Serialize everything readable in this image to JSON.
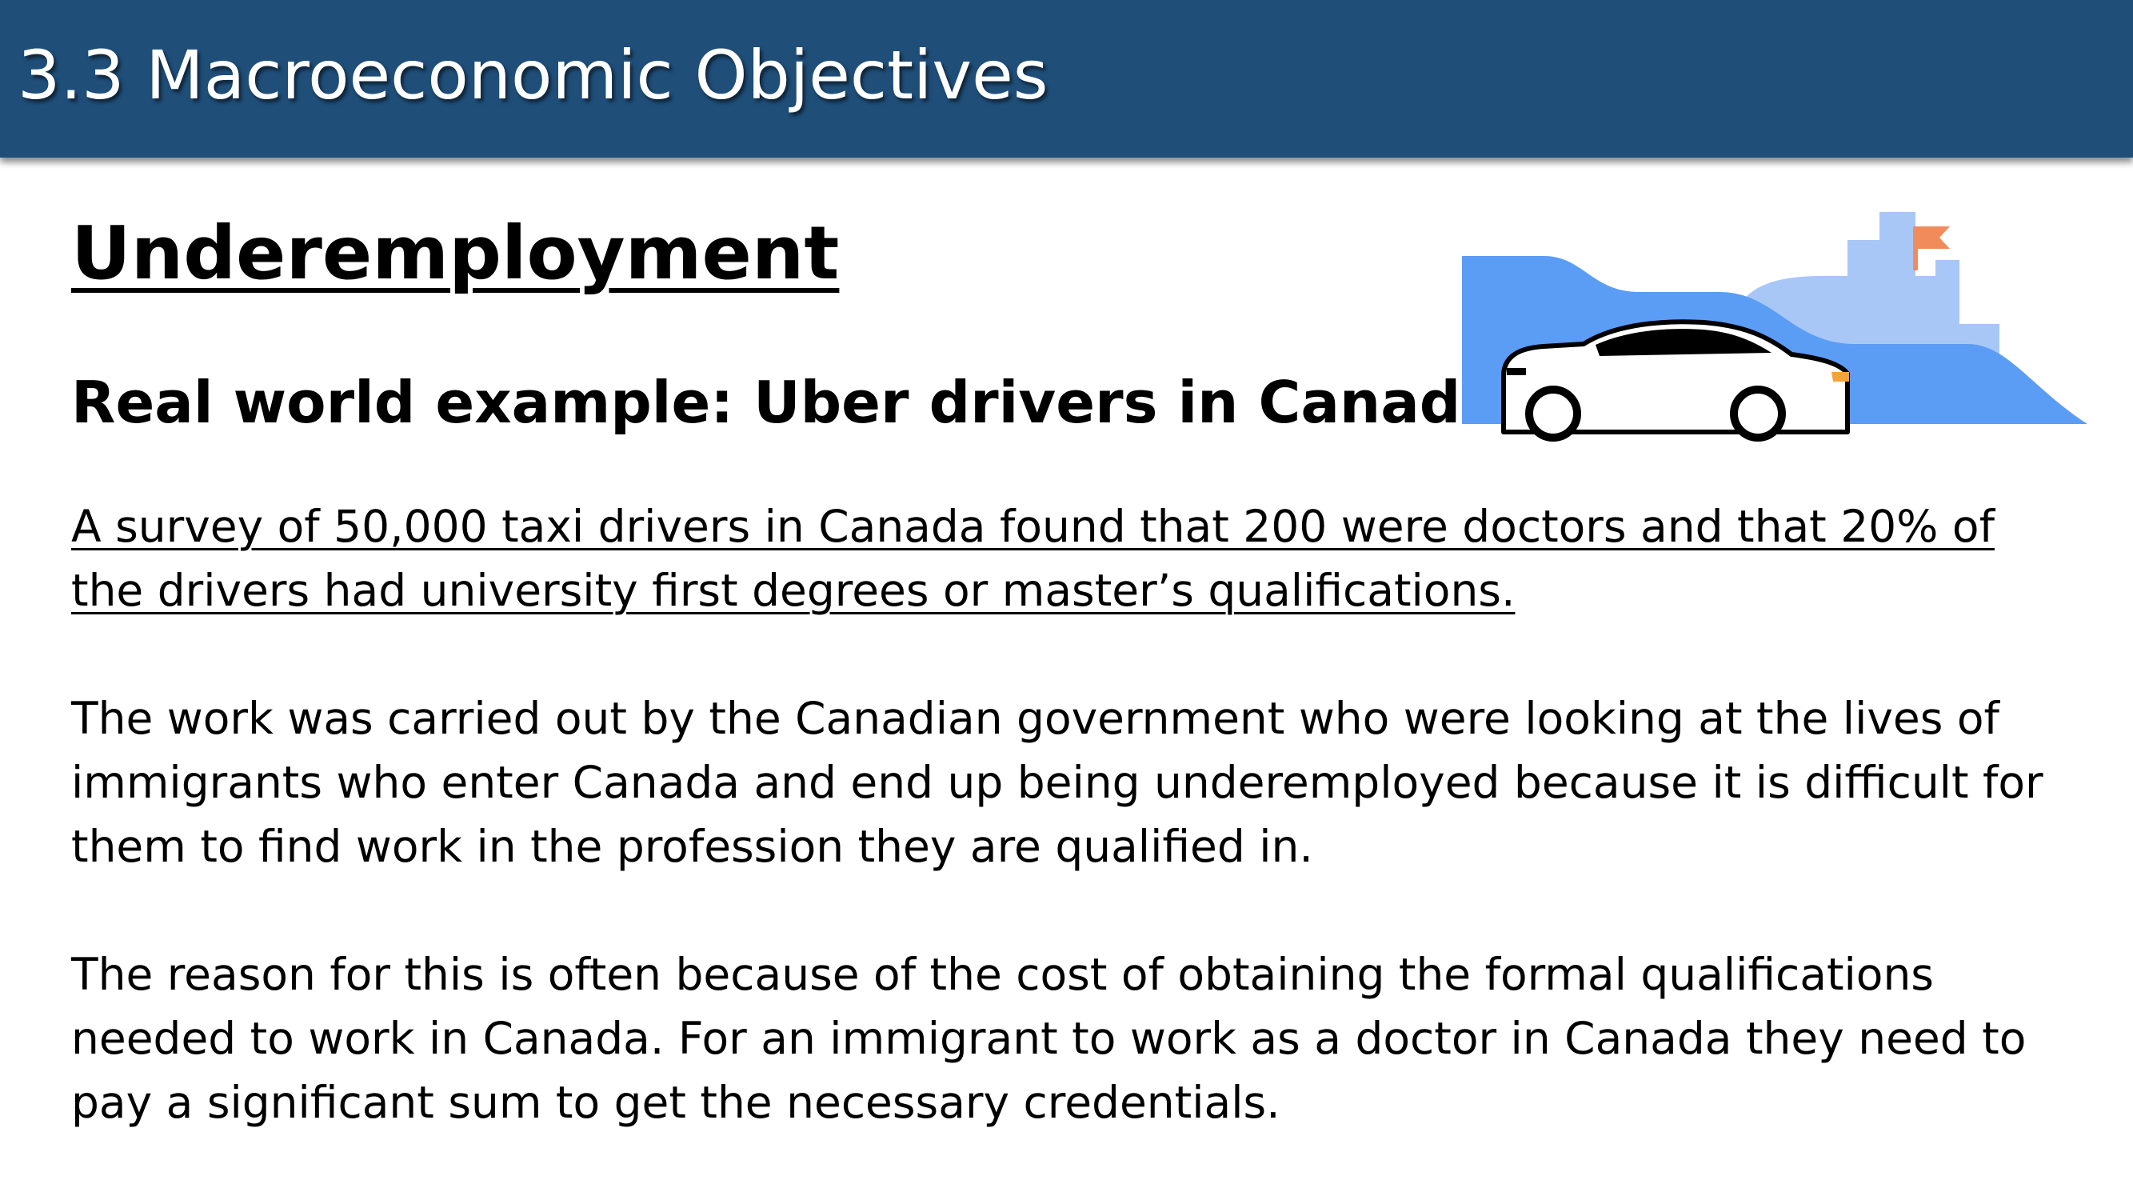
{
  "header": {
    "title": "3.3 Macroeconomic Objectives"
  },
  "main": {
    "heading": "Underemployment",
    "subheading": "Real world example: Uber drivers in Canada",
    "paragraphs": [
      "A survey of 50,000 taxi drivers in Canada found that 200 were doctors and that 20% of the drivers had university first degrees or master’s qualifications.",
      "The work was carried out by the Canadian government who were looking at the lives of immigrants who enter Canada and end up being underemployed because it is difficult for them to find work in the profession they are qualified in.",
      "The reason for this is often because of the cost of obtaining the formal qualifications needed to work in Canada. For an immigrant to work as a doctor in Canada they need to pay a significant sum to get the necessary credentials."
    ]
  },
  "illustration": {
    "icon": "car-city-illustration",
    "colors": {
      "header_bg": "#1f4e79",
      "hill_dark": "#5b9cf5",
      "hill_light": "#a8c7f7",
      "flag": "#f28b5c",
      "car_body": "#ffffff",
      "car_outline": "#000000"
    }
  }
}
